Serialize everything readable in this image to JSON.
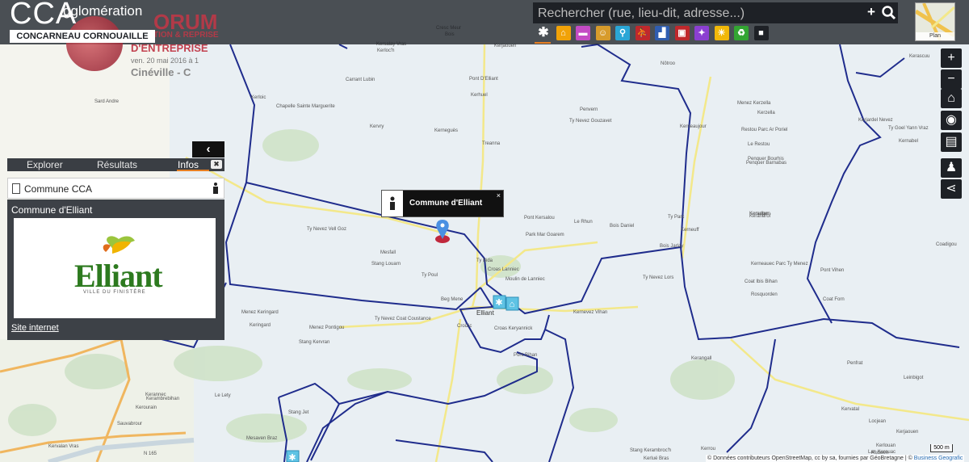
{
  "header": {
    "logo_main": "CCA",
    "logo_agglo": "gglomération",
    "logo_sub": "CONCARNEAU CORNOUAILLE",
    "search_placeholder": "Rechercher (rue, lieu-dit, adresse...)",
    "plus_label": "+",
    "basemap_label": "Plan"
  },
  "forum_banner": {
    "title": "ORUM",
    "line1": "TION & REPRISE",
    "line2": "D'ENTREPRISE",
    "date": "ven. 20 mai 2016 à 1",
    "place": "Cinéville - C"
  },
  "categories": [
    {
      "icon": "asterisk-icon",
      "color": "#1e2126",
      "glyph": "✱"
    },
    {
      "icon": "house-icon",
      "color": "#f1a208",
      "glyph": "⌂"
    },
    {
      "icon": "mortarboard-icon",
      "color": "#c44bc4",
      "glyph": "▬"
    },
    {
      "icon": "theater-masks-icon",
      "color": "#d79b2b",
      "glyph": "☺"
    },
    {
      "icon": "family-icon",
      "color": "#2aa6d6",
      "glyph": "⚲"
    },
    {
      "icon": "running-icon",
      "color": "#c0282c",
      "glyph": "⛹"
    },
    {
      "icon": "chart-icon",
      "color": "#2f5db0",
      "glyph": "▟"
    },
    {
      "icon": "bus-icon",
      "color": "#c0282c",
      "glyph": "▣"
    },
    {
      "icon": "hiker-icon",
      "color": "#8b3fd1",
      "glyph": "✦"
    },
    {
      "icon": "sun-icon",
      "color": "#f1b808",
      "glyph": "☀"
    },
    {
      "icon": "recycle-icon",
      "color": "#33a532",
      "glyph": "♻"
    },
    {
      "icon": "camera-icon",
      "color": "#1e2126",
      "glyph": "■"
    }
  ],
  "tools": [
    {
      "icon": "zoom-in-icon",
      "glyph": "+"
    },
    {
      "icon": "zoom-out-icon",
      "glyph": "−"
    },
    {
      "icon": "home-icon",
      "glyph": "⌂"
    },
    {
      "icon": "locate-icon",
      "glyph": "◉"
    },
    {
      "icon": "print-icon",
      "glyph": "▤"
    },
    {
      "icon": "streetview-icon",
      "glyph": "♟"
    },
    {
      "icon": "share-icon",
      "glyph": "⋖"
    }
  ],
  "side_panel": {
    "collapse_glyph": "‹",
    "tabs": [
      "Explorer",
      "Résultats",
      "Infos"
    ],
    "active_tab": "Infos",
    "close_glyph": "✖",
    "header_title": "Commune CCA",
    "commune_name": "Commune d'Elliant",
    "logo_word": "Elliant",
    "logo_tagline": "VILLE DU FINISTÈRE",
    "site_link": "Site internet"
  },
  "popup": {
    "title": "Commune d'Elliant",
    "close_glyph": "×"
  },
  "map": {
    "scale_label": "500 m",
    "attribution": "© Données contributeurs OpenStreetMap, cc by sa, fournies par GéoBretagne | © ",
    "attribution_link": "Business Geografic",
    "colors": {
      "boundary": "#1f2c8c",
      "road_yellow": "#f3e88a",
      "road_orange": "#f0b65f",
      "forest": "#c9dfc3"
    },
    "places": [
      "Cresc Meur",
      "Bois",
      "Kerjaouen",
      "Kersalay Vras",
      "Kerloc'h",
      "Kerloic",
      "Nôtroo",
      "Carrant Lubin",
      "Pont D'Elliant",
      "Kerhuel",
      "Penvern",
      "Chapelle Sainte Marguerite",
      "Kervry",
      "Kerneguès",
      "Treanna",
      "Ty Nevez Gouzavet",
      "Kerneaujour",
      "Menez Kerzella",
      "Kerzella",
      "Restou Parc Ar Poriel",
      "Le Restou",
      "Penquer Bourhis",
      "Penquer Barnabas",
      "Kervalan",
      "Ty Nevez Vell Goz",
      "Mesfall",
      "Stang Louarn",
      "Ty Poul",
      "Le Rhun",
      "Bois Daniel",
      "Pont Kersalou",
      "Park Mar Goarem",
      "Bois Jarlay",
      "Ty Parc",
      "Kerneuff",
      "Kerandrof",
      "Kerneauec Parc Ty Menez",
      "Coat Ibis Bihan",
      "Rosquorden",
      "Ty Bida",
      "Croas Lanniec",
      "Moulin de Lanniec",
      "Beg Mene",
      "Elliant",
      "Croizic",
      "Croas Keryannick",
      "Pont Bihan",
      "Ty Nevez Coat Coustance",
      "Menez Keringard",
      "Keringard",
      "Menez Pontigou",
      "Stang Kervran",
      "Kernevez Vihan",
      "Ty Nevez Lors",
      "Kerangall",
      "Pont Vihen",
      "Coat Forn",
      "Keradgen",
      "Coadigou",
      "Kerascuu",
      "Kerjardel Nevez",
      "Ty Goel Yann Vraz",
      "Kernabel",
      "Penfrat",
      "Leinbigot",
      "Kervatal",
      "Locjean",
      "Kerjaouen",
      "Kerlouan",
      "Lan Kerouac",
      "Ruduen",
      "Le Lety",
      "Stang Jet",
      "Mesaven Braz",
      "Kerrou",
      "Stang Kerambroc'h",
      "Kerlué Bras",
      "N 165",
      "Kerannec",
      "Kerambrebihan",
      "Kerourain",
      "Sauvabrour",
      "Sard Andre",
      "Kervalan Vras"
    ]
  }
}
